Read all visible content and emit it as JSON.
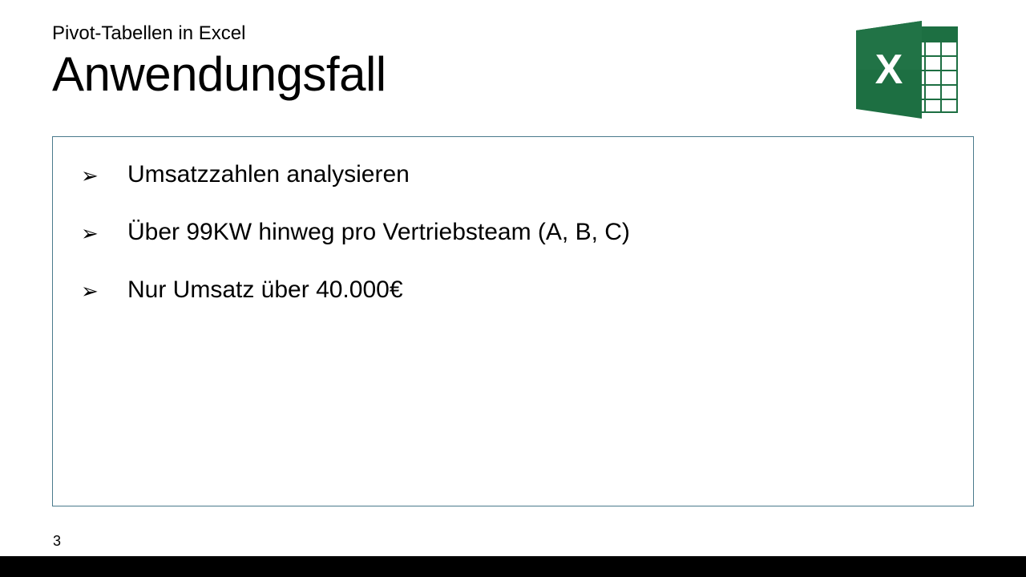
{
  "header": {
    "subtitle": "Pivot-Tabellen in Excel",
    "title": "Anwendungsfall"
  },
  "icon": {
    "name": "excel-icon"
  },
  "content": {
    "bullets": [
      "Umsatzzahlen analysieren",
      "Über 99KW hinweg pro Vertriebsteam (A, B, C)",
      "Nur Umsatz über 40.000€"
    ]
  },
  "footer": {
    "page_number": "3"
  },
  "colors": {
    "box_border": "#4A7A8C",
    "excel_green": "#1D6F42",
    "excel_green_dark": "#185C37"
  }
}
